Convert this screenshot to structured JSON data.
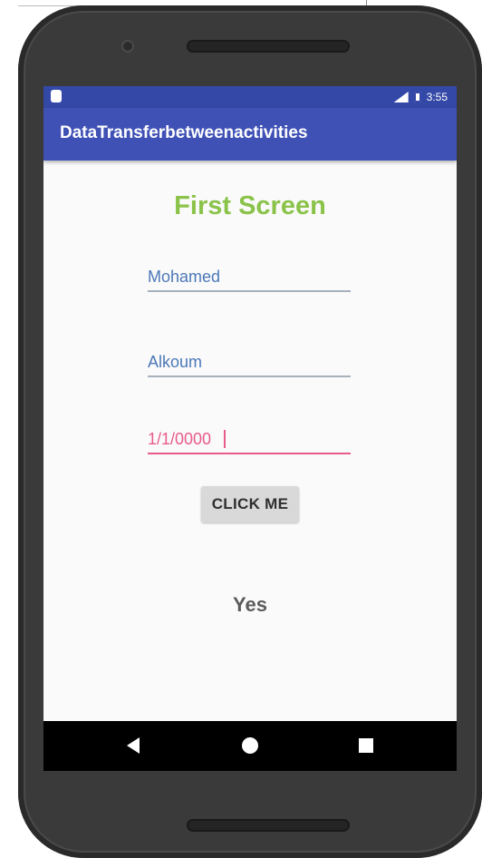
{
  "status_bar": {
    "time": "3:55"
  },
  "app_bar": {
    "title": "DataTransferbetweenactivities"
  },
  "screen": {
    "heading": "First Screen",
    "fields": [
      {
        "value": "Mohamed"
      },
      {
        "value": "Alkoum"
      },
      {
        "value": "1/1/0000"
      }
    ],
    "button_label": "CLICK ME",
    "result_text": "Yes"
  },
  "icons": {
    "status_left": "sim-card-icon",
    "signal": "signal-icon",
    "battery": "battery-icon",
    "nav_back": "back-icon",
    "nav_home": "home-icon",
    "nav_recent": "recent-apps-icon"
  },
  "colors": {
    "status_bar": "#3448a7",
    "app_bar": "#3f51b5",
    "heading": "#8bc34a",
    "focused_field": "#e85b8a",
    "field_text": "#4c78b8"
  }
}
